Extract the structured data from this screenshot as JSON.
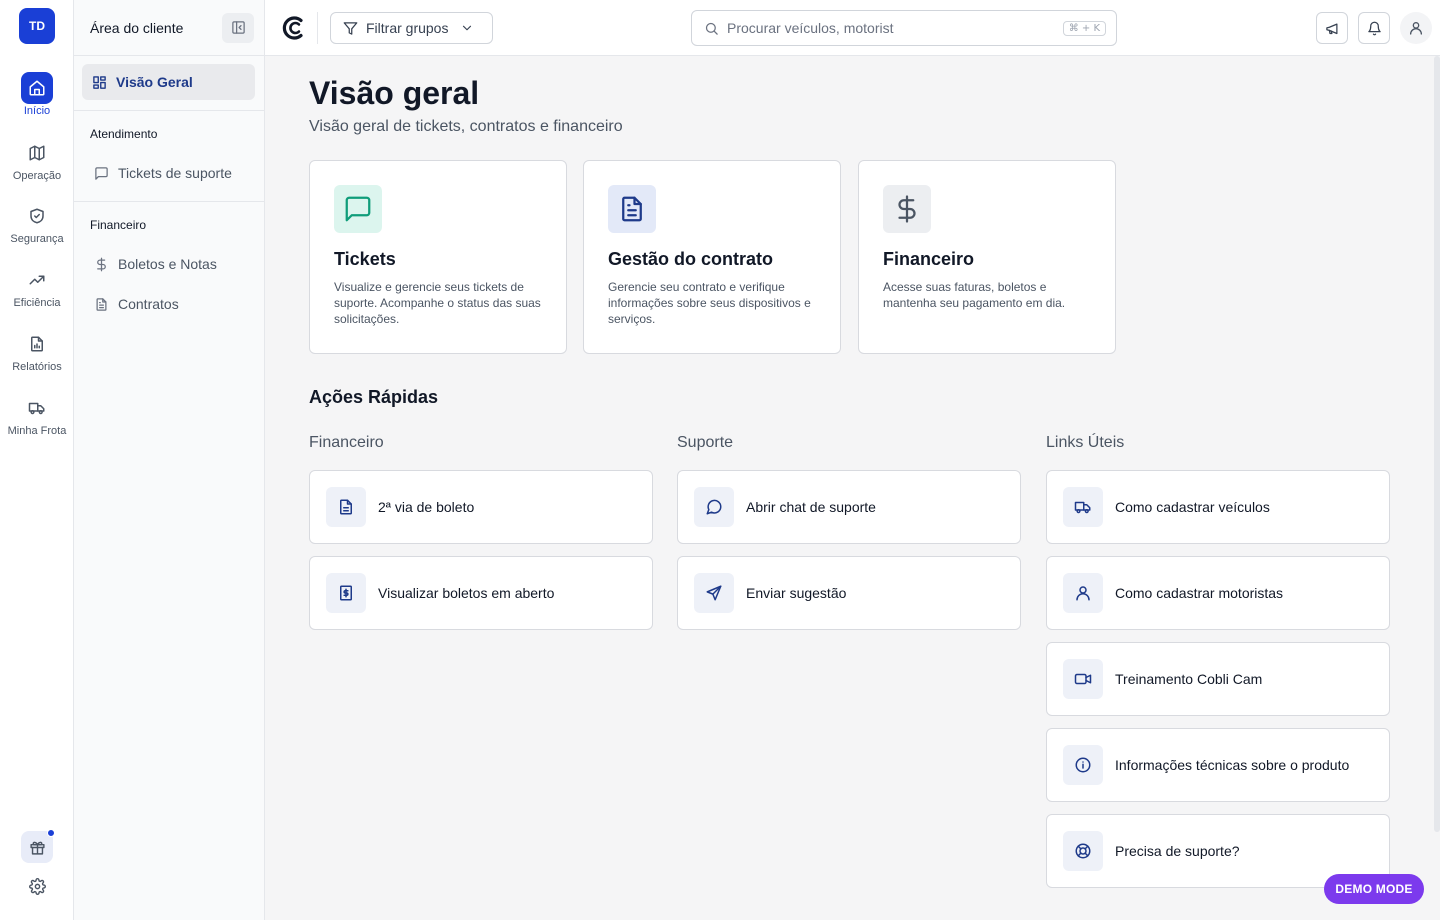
{
  "rail": {
    "avatar": "TD",
    "items": [
      {
        "label": "Início",
        "icon": "home-icon"
      },
      {
        "label": "Operação",
        "icon": "map-icon"
      },
      {
        "label": "Segurança",
        "icon": "shield-icon"
      },
      {
        "label": "Eficiência",
        "icon": "trend-icon"
      },
      {
        "label": "Relatórios",
        "icon": "report-icon"
      },
      {
        "label": "Minha Frota",
        "icon": "truck-icon"
      }
    ]
  },
  "sidebar": {
    "title": "Área do cliente",
    "active_item": "Visão Geral",
    "sections": [
      {
        "title": "Atendimento",
        "items": [
          {
            "label": "Tickets de suporte"
          }
        ]
      },
      {
        "title": "Financeiro",
        "items": [
          {
            "label": "Boletos e Notas"
          },
          {
            "label": "Contratos"
          }
        ]
      }
    ]
  },
  "topbar": {
    "filter_label": "Filtrar grupos",
    "search_placeholder": "Procurar veículos, motorist",
    "search_shortcut": "⌘ + K"
  },
  "main": {
    "title": "Visão geral",
    "subtitle": "Visão geral de tickets, contratos e financeiro",
    "cards": [
      {
        "title": "Tickets",
        "description": "Visualize e gerencie seus tickets de suporte. Acompanhe o status das suas solicitações.",
        "color": "#0f9d7a",
        "bg": "#dcf5ee"
      },
      {
        "title": "Gestão do contrato",
        "description": "Gerencie seu contrato e verifique informações sobre seus dispositivos e serviços.",
        "color": "#1e3a8a",
        "bg": "#e3e9f8"
      },
      {
        "title": "Financeiro",
        "description": "Acesse suas faturas, boletos e mantenha seu pagamento em dia.",
        "color": "#4b5563",
        "bg": "#eceef1"
      }
    ],
    "quick_actions_title": "Ações Rápidas",
    "columns": [
      {
        "title": "Financeiro",
        "actions": [
          "2ª via de boleto",
          "Visualizar boletos em aberto"
        ]
      },
      {
        "title": "Suporte",
        "actions": [
          "Abrir chat de suporte",
          "Enviar sugestão"
        ]
      },
      {
        "title": "Links Úteis",
        "actions": [
          "Como cadastrar veículos",
          "Como cadastrar motoristas",
          "Treinamento Cobli Cam",
          "Informações técnicas sobre o produto",
          "Precisa de suporte?"
        ]
      }
    ]
  },
  "demo_badge": "DEMO MODE",
  "colors": {
    "primary": "#1a3fd6",
    "navy": "#1e3a8a",
    "demo": "#7c3aed"
  }
}
